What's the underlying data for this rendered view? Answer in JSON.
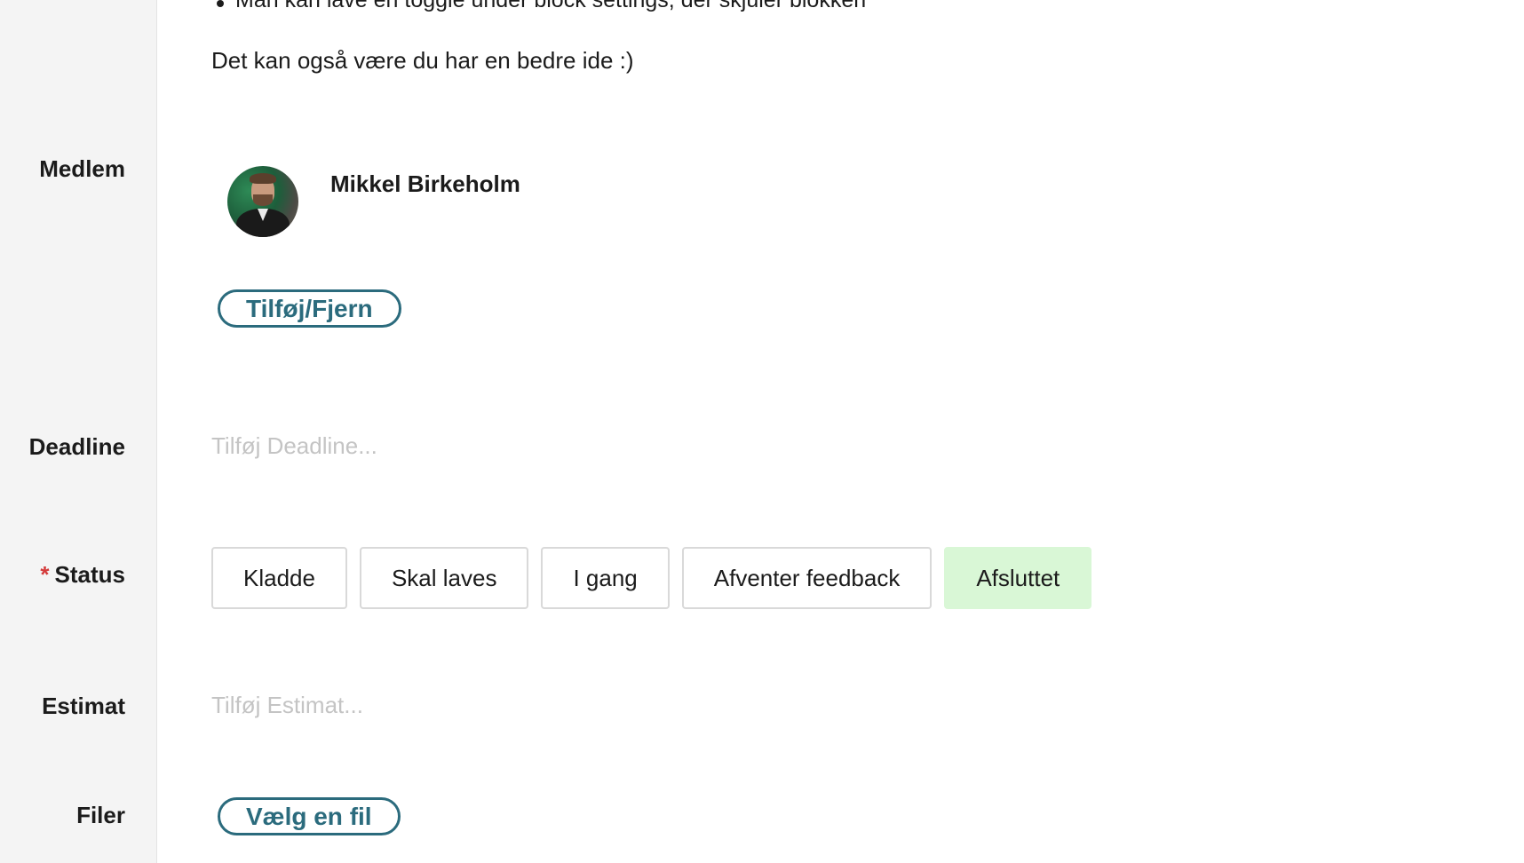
{
  "description": {
    "bullet_text": "Man kan lave en toggle under block settings, der skjuler blokken",
    "paragraph": "Det kan også være du har en bedre ide :)"
  },
  "fields": {
    "member_label": "Medlem",
    "deadline_label": "Deadline",
    "status_label": "Status",
    "status_required_marker": "*",
    "estimate_label": "Estimat",
    "files_label": "Filer"
  },
  "member": {
    "name": "Mikkel Birkeholm",
    "add_remove_label": "Tilføj/Fjern"
  },
  "deadline": {
    "placeholder": "Tilføj Deadline...",
    "value": ""
  },
  "status": {
    "options": [
      "Kladde",
      "Skal laves",
      "I gang",
      "Afventer feedback",
      "Afsluttet"
    ],
    "selected": "Afsluttet",
    "selected_color": "#d9f7d6"
  },
  "estimate": {
    "placeholder": "Tilføj Estimat...",
    "value": ""
  },
  "files": {
    "choose_label": "Vælg en fil"
  },
  "colors": {
    "accent": "#2b6b7d",
    "label_column_bg": "#f4f4f4",
    "required": "#d43a3a",
    "placeholder": "#c4c4c4"
  }
}
